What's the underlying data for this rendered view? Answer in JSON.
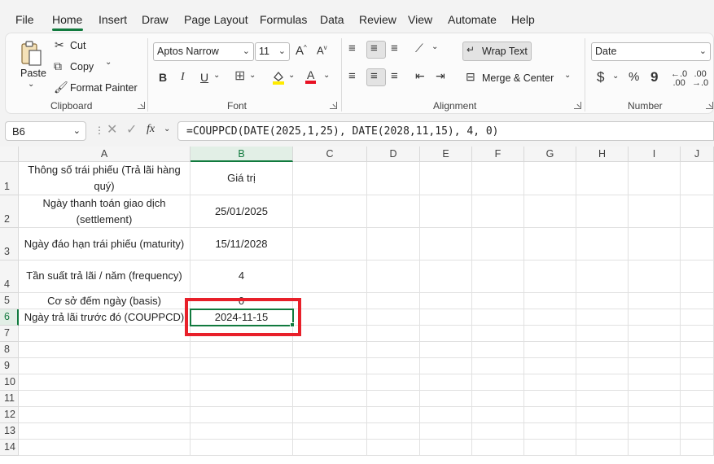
{
  "menu": {
    "tabs": [
      "File",
      "Home",
      "Insert",
      "Draw",
      "Page Layout",
      "Formulas",
      "Data",
      "Review",
      "View",
      "Automate",
      "Help"
    ],
    "active": "Home"
  },
  "ribbon": {
    "clipboard": {
      "paste": "Paste",
      "cut": "Cut",
      "copy": "Copy",
      "format_painter": "Format Painter",
      "label": "Clipboard"
    },
    "font": {
      "name": "Aptos Narrow",
      "size": "11",
      "grow": "A",
      "shrink": "A",
      "bold": "B",
      "italic": "I",
      "underline": "U",
      "font_color_letter": "A",
      "label": "Font"
    },
    "alignment": {
      "wrap_text": "Wrap Text",
      "merge_center": "Merge & Center",
      "label": "Alignment"
    },
    "number": {
      "format": "Date",
      "currency": "$",
      "percent": "%",
      "comma": "9",
      "label": "Number"
    }
  },
  "formula_bar": {
    "name_box": "B6",
    "fx": "fx",
    "formula": "=COUPPCD(DATE(2025,1,25), DATE(2028,11,15), 4, 0)"
  },
  "sheet": {
    "columns": [
      "A",
      "B",
      "C",
      "D",
      "E",
      "F",
      "G",
      "H",
      "I",
      "J"
    ],
    "rows": [
      "1",
      "2",
      "3",
      "4",
      "5",
      "6",
      "7",
      "8",
      "9",
      "10",
      "11",
      "12",
      "13",
      "14"
    ],
    "cells": {
      "A1": "Thông số trái phiếu (Trả lãi hàng quý)",
      "B1": "Giá trị",
      "A2": "Ngày thanh toán giao dịch (settlement)",
      "B2": "25/01/2025",
      "A3": "Ngày đáo hạn trái phiếu (maturity)",
      "B3": "15/11/2028",
      "A4": "Tần suất trả lãi / năm (frequency)",
      "B4": "4",
      "A5": "Cơ sở đếm ngày (basis)",
      "B5": "0",
      "A6": "Ngày trả lãi trước đó (COUPPCD)",
      "B6": "2024-11-15"
    },
    "active_cell": "B6"
  },
  "colors": {
    "accent": "#117a3e",
    "highlight_box": "#e8202a"
  }
}
